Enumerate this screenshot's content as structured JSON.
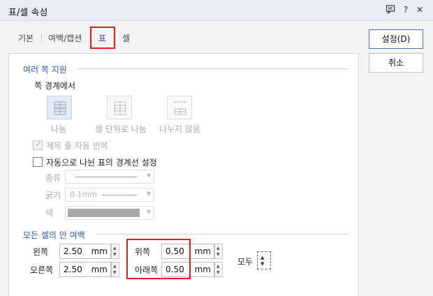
{
  "window": {
    "title": "표/셀 속성"
  },
  "titlebar_icons": [
    "message-icon",
    "help-icon",
    "close-icon"
  ],
  "titlebar_glyphs": {
    "help": "?",
    "close": "✕"
  },
  "tabs": [
    {
      "label": "기본"
    },
    {
      "label": "여백/캡션"
    },
    {
      "label": "표"
    },
    {
      "label": "셀"
    }
  ],
  "buttons": {
    "ok": "설정(D)",
    "cancel": "취소"
  },
  "split": {
    "title": "여러 쪽 지원",
    "boundary_label": "쪽 경계에서",
    "options": [
      {
        "label": "나눔"
      },
      {
        "label": "셀 단위로 나눔"
      },
      {
        "label": "나누지 않음"
      }
    ],
    "repeat_title": "제목 줄 자동 반복",
    "auto_border": "자동으로 나뉜 표의 경계선 설정",
    "type_label": "종류",
    "thickness_label": "굵기",
    "thickness_value": "0.1mm",
    "color_label": "색"
  },
  "margins": {
    "title": "모든 셀의 안 여백",
    "left_label": "왼쪽",
    "left_value": "2.50",
    "right_label": "오른쪽",
    "right_value": "2.50",
    "top_label": "위쪽",
    "top_value": "0.50",
    "bottom_label": "아래쪽",
    "bottom_value": "0.50",
    "unit": "mm",
    "all_label": "모두"
  },
  "colors": {
    "accent": "#2d57a6",
    "highlight": "#e21b1b"
  }
}
